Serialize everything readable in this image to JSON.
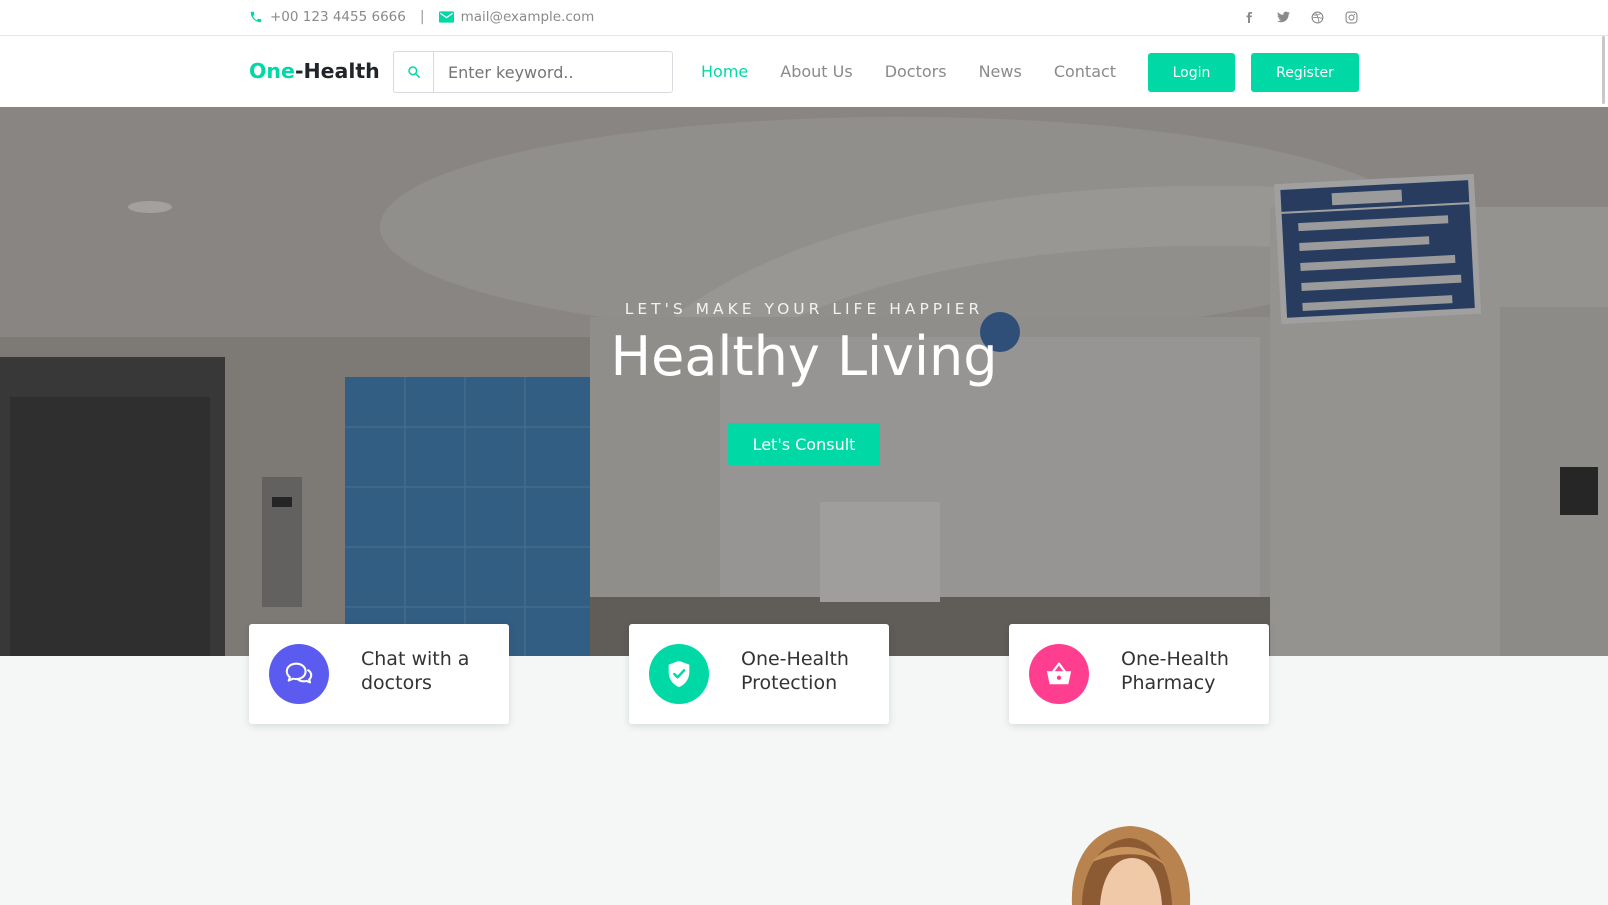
{
  "topbar": {
    "phone": "+00 123 4455 6666",
    "separator": "|",
    "email": "mail@example.com",
    "social": [
      "facebook-icon",
      "twitter-icon",
      "dribbble-icon",
      "instagram-icon"
    ]
  },
  "navbar": {
    "brand_accent": "One",
    "brand_rest": "-Health",
    "search_placeholder": "Enter keyword..",
    "links": [
      "Home",
      "About Us",
      "Doctors",
      "News",
      "Contact"
    ],
    "active_link": "Home",
    "login": "Login",
    "register": "Register"
  },
  "hero": {
    "subtitle": "LET'S MAKE YOUR LIFE HAPPIER",
    "title": "Healthy Living",
    "cta": "Let's Consult"
  },
  "features": [
    {
      "label": "Chat with a doctors",
      "icon": "chat-icon",
      "color": "#5b5bf0"
    },
    {
      "label": "One-Health Protection",
      "icon": "shield-icon",
      "color": "#00d9a5"
    },
    {
      "label": "One-Health Pharmacy",
      "icon": "basket-icon",
      "color": "#ff3e8f"
    }
  ],
  "colors": {
    "accent": "#00d9a5",
    "muted": "#8a8a8a",
    "background": "#f4f7f6"
  }
}
